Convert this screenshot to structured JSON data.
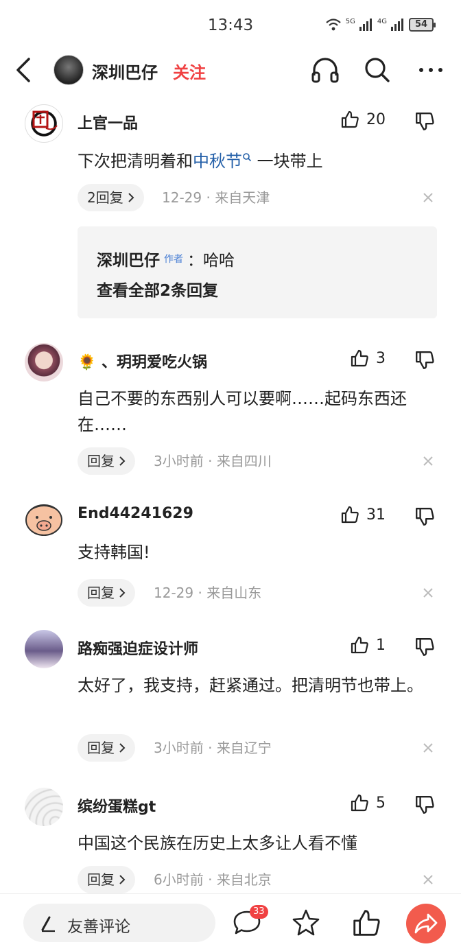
{
  "status": {
    "time": "13:43",
    "battery": "54",
    "signal1": "5G",
    "signal2": "4G"
  },
  "header": {
    "author_name": "深圳巴仔",
    "follow_label": "关注"
  },
  "comments": [
    {
      "name": "上官一品",
      "likes": "20",
      "text_before": "下次把清明着和",
      "link_text": "中秋节",
      "text_after": " 一块带上",
      "reply_label": "2回复",
      "time": "12-29",
      "location": "来自天津",
      "sub": {
        "name": "深圳巴仔",
        "tag": "作者",
        "text": "：哈哈",
        "view_all": "查看全部2条回复"
      }
    },
    {
      "name": "🌻 、玥玥爱吃火锅",
      "likes": "3",
      "text": "自己不要的东西别人可以要啊……起码东西还在……",
      "reply_label": "回复",
      "time": "3小时前",
      "location": "来自四川"
    },
    {
      "name": "End44241629",
      "likes": "31",
      "text": "支持韩国!",
      "reply_label": "回复",
      "time": "12-29",
      "location": "来自山东"
    },
    {
      "name": "路痴强迫症设计师",
      "likes": "1",
      "text": "太好了，我支持，赶紧通过。把清明节也带上。",
      "reply_label": "回复",
      "time": "3小时前",
      "location": "来自辽宁"
    },
    {
      "name": "缤纷蛋糕gt",
      "likes": "5",
      "text": "中国这个民族在历史上太多让人看不懂",
      "reply_label": "回复",
      "time": "6小时前",
      "location": "来自北京"
    }
  ],
  "bottom": {
    "input_placeholder": "友善评论",
    "comment_count": "33"
  },
  "colors": {
    "accent_red": "#f04142",
    "link_blue": "#235fa8",
    "share_orange": "#f25b4d"
  },
  "icons": [
    "back-icon",
    "headphones-icon",
    "search-icon",
    "more-icon",
    "thumbs-up-icon",
    "thumbs-down-icon",
    "close-icon",
    "chevron-right-icon",
    "pen-icon",
    "comment-icon",
    "star-icon",
    "share-icon"
  ]
}
